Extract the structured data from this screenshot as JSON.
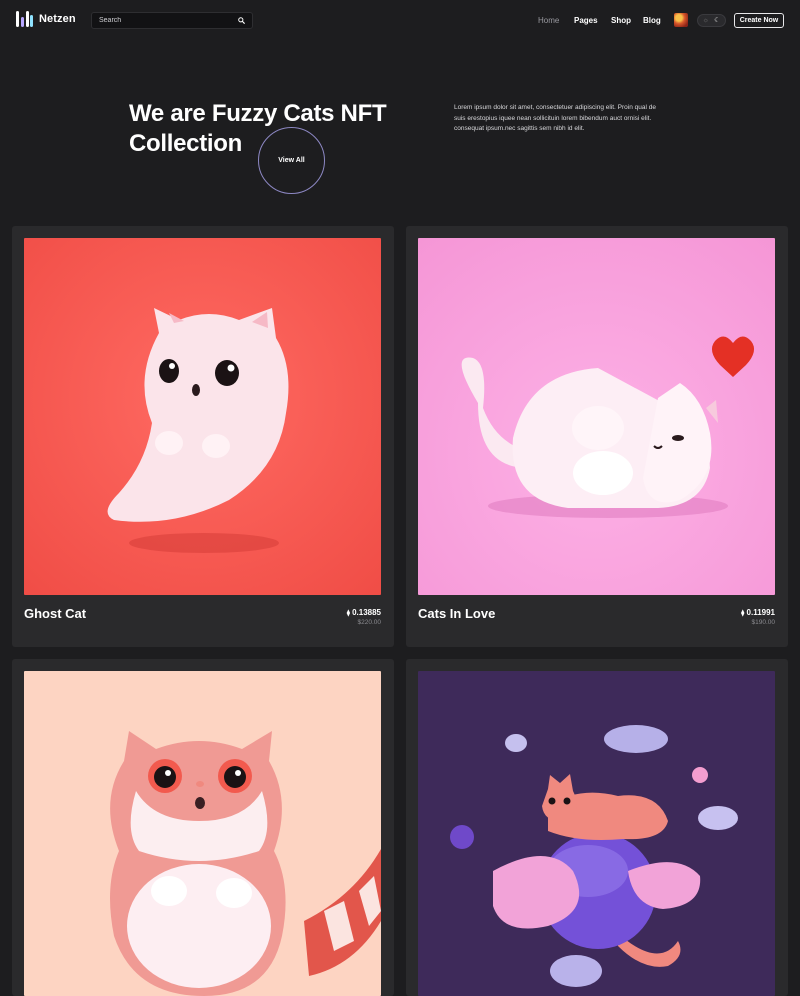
{
  "header": {
    "brand": "Netzen",
    "search_placeholder": "Search",
    "nav": [
      {
        "label": "Home",
        "active": true
      },
      {
        "label": "Pages",
        "active": false
      },
      {
        "label": "Shop",
        "active": false
      },
      {
        "label": "Blog",
        "active": false
      }
    ],
    "theme_toggle": {
      "light_icon": "sun-icon",
      "dark_icon": "moon-icon"
    },
    "create_label": "Create Now"
  },
  "hero": {
    "title": "We are Fuzzy Cats NFT Collection",
    "view_all": "View All",
    "description": "Lorem ipsum dolor sit amet, consectetuer adipiscing elit. Proin qual de suis erestopius iquee nean sollicituin lorem bibendum auct ornisi elit. consequat ipsum.nec sagittis sem nibh id elit."
  },
  "cards": [
    {
      "name": "Ghost Cat",
      "price": "0.13885",
      "usd": "$220.00",
      "bg": "#f5564f"
    },
    {
      "name": "Cats In Love",
      "price": "0.11991",
      "usd": "$190.00",
      "bg": "#f8a0dc"
    },
    {
      "name": "",
      "price": "",
      "usd": "",
      "bg": "#fcd3c0"
    },
    {
      "name": "",
      "price": "",
      "usd": "",
      "bg": "#3e2a5a"
    }
  ],
  "colors": {
    "background": "#1d1d1f",
    "card": "#2a2a2c",
    "accent_ring": "#8d88c4"
  },
  "icons": {
    "logo": "netzen-logo-icon",
    "search": "search-icon",
    "eth": "ethereum-icon"
  }
}
